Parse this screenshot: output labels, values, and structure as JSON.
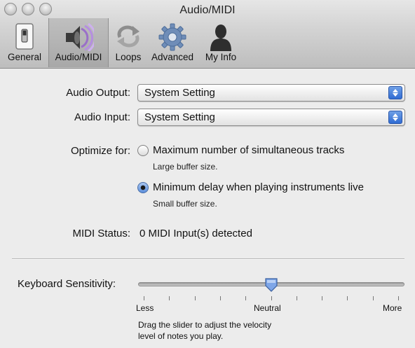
{
  "window": {
    "title": "Audio/MIDI",
    "buttons": [
      "close",
      "minimize",
      "zoom"
    ]
  },
  "toolbar": {
    "items": [
      {
        "label": "General",
        "icon": "switch-icon",
        "selected": false
      },
      {
        "label": "Audio/MIDI",
        "icon": "speaker-icon",
        "selected": true
      },
      {
        "label": "Loops",
        "icon": "loop-arrows-icon",
        "selected": false
      },
      {
        "label": "Advanced",
        "icon": "gear-icon",
        "selected": false
      },
      {
        "label": "My Info",
        "icon": "person-icon",
        "selected": false
      }
    ]
  },
  "audio_output": {
    "label": "Audio Output:",
    "value": "System Setting"
  },
  "audio_input": {
    "label": "Audio Input:",
    "value": "System Setting"
  },
  "optimize": {
    "label": "Optimize for:",
    "options": [
      {
        "title": "Maximum number of simultaneous tracks",
        "subtitle": "Large buffer size.",
        "selected": false
      },
      {
        "title": "Minimum delay when playing instruments live",
        "subtitle": "Small buffer size.",
        "selected": true
      }
    ]
  },
  "midi_status": {
    "label": "MIDI Status:",
    "value": "0 MIDI Input(s) detected"
  },
  "keyboard_sensitivity": {
    "label": "Keyboard Sensitivity:",
    "min_label": "Less",
    "mid_label": "Neutral",
    "max_label": "More",
    "position": 0.5,
    "ticks": 11,
    "hint_line1": "Drag the slider to adjust the velocity",
    "hint_line2": "level of notes you play."
  },
  "colors": {
    "accent": "#3a73d6",
    "background": "#ececec"
  }
}
